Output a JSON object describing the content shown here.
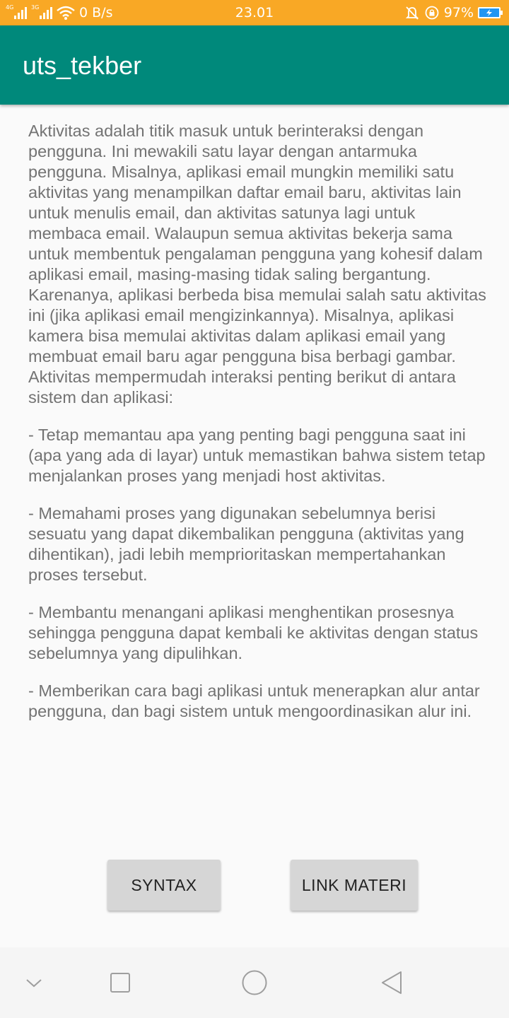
{
  "status_bar": {
    "network_4g": "4G",
    "network_3g": "3G",
    "speed": "0 B/s",
    "time": "23.01",
    "battery": "97%",
    "icons": [
      "signal-icon",
      "wifi-icon",
      "alarm-off-icon",
      "rotation-lock-icon",
      "battery-charging-icon"
    ],
    "color": "#f9a825"
  },
  "app_bar": {
    "title": "uts_tekber",
    "color": "#00897b"
  },
  "content": {
    "paragraphs": [
      "Aktivitas adalah titik masuk untuk berinteraksi dengan pengguna. Ini mewakili satu layar dengan antarmuka pengguna. Misalnya, aplikasi email mungkin memiliki satu aktivitas yang menampilkan daftar email baru, aktivitas lain untuk menulis email, dan aktivitas satunya lagi untuk membaca email. Walaupun semua aktivitas bekerja sama untuk membentuk pengalaman pengguna yang kohesif dalam aplikasi email, masing-masing tidak saling bergantung. Karenanya, aplikasi berbeda bisa memulai salah satu aktivitas ini (jika aplikasi email mengizinkannya). Misalnya, aplikasi kamera bisa memulai aktivitas dalam aplikasi email yang membuat email baru agar pengguna bisa berbagi gambar. Aktivitas mempermudah interaksi penting berikut di antara sistem dan aplikasi:",
      "- Tetap memantau apa yang penting bagi pengguna saat ini (apa yang ada di layar) untuk memastikan bahwa sistem tetap menjalankan proses yang menjadi host aktivitas.",
      "- Memahami proses yang digunakan sebelumnya berisi sesuatu yang dapat dikembalikan pengguna (aktivitas yang dihentikan), jadi lebih memprioritaskan mempertahankan proses tersebut.",
      "- Membantu menangani aplikasi menghentikan prosesnya sehingga pengguna dapat kembali ke aktivitas dengan status sebelumnya yang dipulihkan.",
      "- Memberikan cara bagi aplikasi untuk menerapkan alur antar pengguna, dan bagi sistem untuk mengoordinasikan alur ini."
    ]
  },
  "buttons": {
    "syntax": "SYNTAX",
    "link_materi": "LINK MATERI"
  },
  "nav_bar": {
    "icons": [
      "chevron-down-icon",
      "recents-icon",
      "home-icon",
      "back-icon"
    ]
  }
}
